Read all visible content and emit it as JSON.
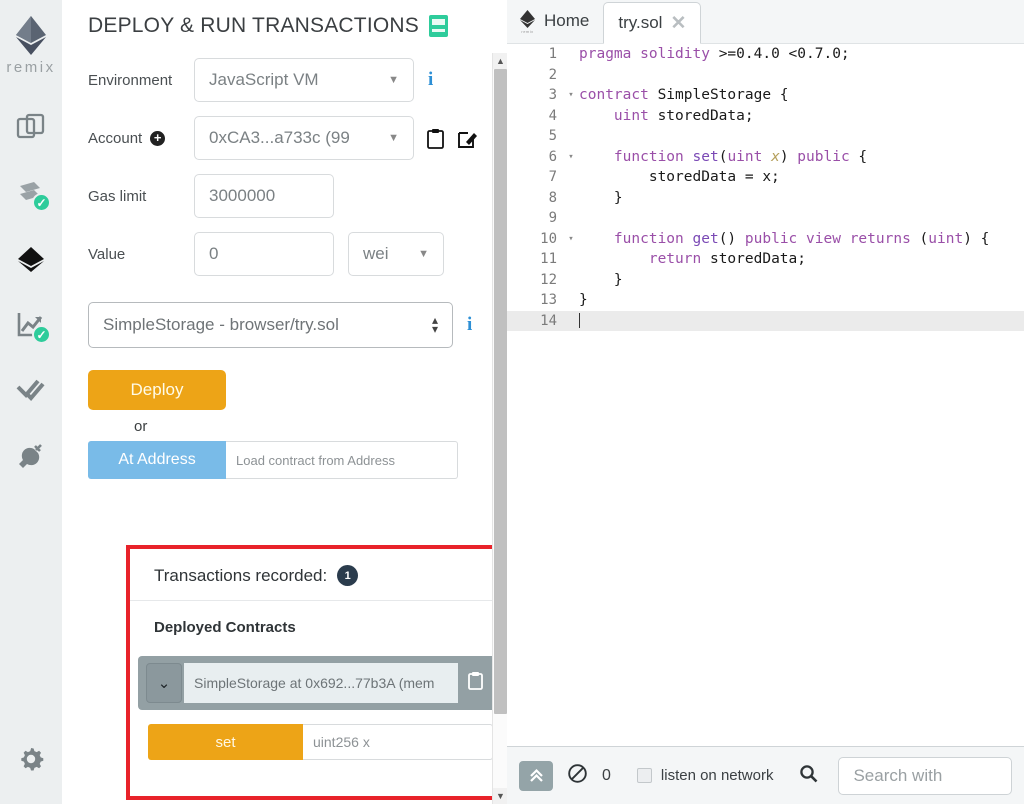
{
  "iconbar": {
    "logo_label": "remix",
    "items": [
      {
        "name": "file-explorers",
        "icon": "files-icon",
        "badge": ""
      },
      {
        "name": "solidity-compiler",
        "icon": "compiler-icon",
        "badge": "✓"
      },
      {
        "name": "deploy-run-transactions",
        "icon": "ethereum-icon",
        "badge": ""
      },
      {
        "name": "solidity-static-analysis",
        "icon": "analysis-chart-icon",
        "badge": "✓"
      },
      {
        "name": "debugger",
        "icon": "double-check-icon",
        "badge": ""
      },
      {
        "name": "plugin-manager",
        "icon": "plug-icon",
        "badge": ""
      }
    ],
    "settings_icon": "gear-icon"
  },
  "panel": {
    "title": "DEPLOY & RUN TRANSACTIONS",
    "docs_icon": "book-icon",
    "environment": {
      "label": "Environment",
      "value": "JavaScript VM",
      "info_icon": "info-icon"
    },
    "account": {
      "label": "Account",
      "add_icon": "plus-circle-icon",
      "value": "0xCA3...a733c (99",
      "copy_icon": "clipboard-icon",
      "edit_icon": "edit-square-icon"
    },
    "gas_limit": {
      "label": "Gas limit",
      "value": "3000000"
    },
    "value": {
      "label": "Value",
      "value": "0",
      "unit": "wei"
    },
    "contract": {
      "value": "SimpleStorage - browser/try.sol",
      "info_icon": "info-icon"
    },
    "deploy_label": "Deploy",
    "or_label": "or",
    "at_address_label": "At Address",
    "at_address_placeholder": "Load contract from Address"
  },
  "transactions": {
    "recorded_label": "Transactions recorded:",
    "recorded_count": "1",
    "collapse_icon": "chevron-down-icon",
    "deployed_title": "Deployed Contracts",
    "trash_icon": "trash-icon",
    "instance": {
      "toggle_icon": "chevron-down-icon",
      "label": "SimpleStorage at 0x692...77b3A (mem",
      "copy_icon": "clipboard-icon",
      "close_icon": "close-icon"
    },
    "functions": [
      {
        "name": "set",
        "placeholder": "uint256 x",
        "expand_icon": "chevron-down-icon"
      }
    ],
    "highlight_color": "#e8222a"
  },
  "editor": {
    "tabs": [
      {
        "label": "Home",
        "icon": "remix-logo-icon",
        "active": false,
        "closable": false
      },
      {
        "label": "try.sol",
        "icon": "",
        "active": true,
        "closable": true
      }
    ],
    "close_icon": "close-icon",
    "current_line": 14,
    "lines": [
      {
        "n": "1",
        "fold": "",
        "text": "pragma solidity >=0.4.0 <0.7.0;"
      },
      {
        "n": "2",
        "fold": "",
        "text": ""
      },
      {
        "n": "3",
        "fold": "▾",
        "text": "contract SimpleStorage {"
      },
      {
        "n": "4",
        "fold": "",
        "text": "    uint storedData;"
      },
      {
        "n": "5",
        "fold": "",
        "text": ""
      },
      {
        "n": "6",
        "fold": "▾",
        "text": "    function set(uint x) public {"
      },
      {
        "n": "7",
        "fold": "",
        "text": "        storedData = x;"
      },
      {
        "n": "8",
        "fold": "",
        "text": "    }"
      },
      {
        "n": "9",
        "fold": "",
        "text": ""
      },
      {
        "n": "10",
        "fold": "▾",
        "text": "    function get() public view returns (uint) {"
      },
      {
        "n": "11",
        "fold": "",
        "text": "        return storedData;"
      },
      {
        "n": "12",
        "fold": "",
        "text": "    }"
      },
      {
        "n": "13",
        "fold": "",
        "text": "}"
      },
      {
        "n": "14",
        "fold": "",
        "text": ""
      }
    ]
  },
  "terminal": {
    "expand_icon": "chevrons-up-icon",
    "clear_icon": "ban-icon",
    "pending_count": "0",
    "listen_label": "listen on network",
    "search_icon": "search-icon",
    "search_placeholder": "Search with"
  },
  "colors": {
    "accent_orange": "#eda417",
    "accent_blue": "#79bbe8",
    "badge_green": "#2ecc9b",
    "badge_navy": "#2b3c4d",
    "highlight_red": "#e8222a",
    "instance_gray": "#93a0a4"
  }
}
